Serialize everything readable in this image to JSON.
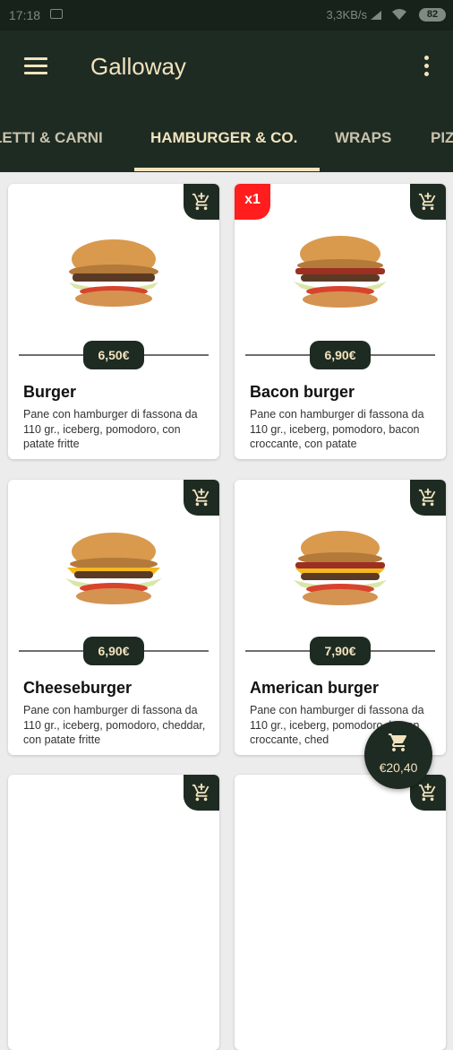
{
  "status_bar": {
    "time": "17:18",
    "network_speed": "3,3KB/s",
    "battery": "82"
  },
  "app_bar": {
    "title": "Galloway"
  },
  "tabs": [
    {
      "label": "LETTI & CARNI"
    },
    {
      "label": "HAMBURGER & CO."
    },
    {
      "label": "WRAPS"
    },
    {
      "label": "PIZ"
    }
  ],
  "active_tab": "HAMBURGER & CO.",
  "products": [
    {
      "name": "Burger",
      "price": "6,50€",
      "description": "Pane con hamburger di fassona da 110 gr., iceberg, pomodoro, con patate fritte",
      "in_cart": ""
    },
    {
      "name": "Bacon burger",
      "price": "6,90€",
      "description": "Pane con hamburger di fassona da 110 gr., iceberg, pomodoro, bacon croccante, con patate",
      "in_cart": "x1"
    },
    {
      "name": "Cheeseburger",
      "price": "6,90€",
      "description": "Pane con hamburger di fassona da 110 gr., iceberg, pomodoro, cheddar, con patate fritte",
      "in_cart": ""
    },
    {
      "name": "American burger",
      "price": "7,90€",
      "description": "Pane con hamburger di fassona da 110 gr., iceberg, pomodoro, bacon croccante, ched",
      "in_cart": ""
    }
  ],
  "cart": {
    "total": "€20,40"
  },
  "colors": {
    "primary": "#1e2b22",
    "accent": "#f1e3bf",
    "badge": "#ff1d1d"
  },
  "icons": [
    "menu-icon",
    "more-vert-icon",
    "add-to-cart-icon",
    "cart-icon"
  ]
}
